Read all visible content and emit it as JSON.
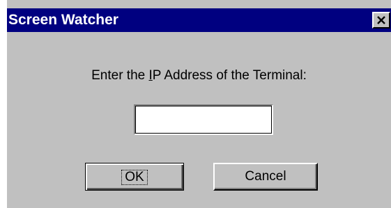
{
  "window": {
    "title": "Screen Watcher",
    "close_icon": "close-x-icon"
  },
  "dialog": {
    "prompt_before": "Enter the ",
    "prompt_mnemonic": "I",
    "prompt_after": "P Address of the Terminal:",
    "ip_input_value": "",
    "ok_label": "OK",
    "cancel_label": "Cancel"
  },
  "colors": {
    "titlebar": "#000080",
    "title_text": "#ffffff",
    "face": "#c0c0c0"
  }
}
